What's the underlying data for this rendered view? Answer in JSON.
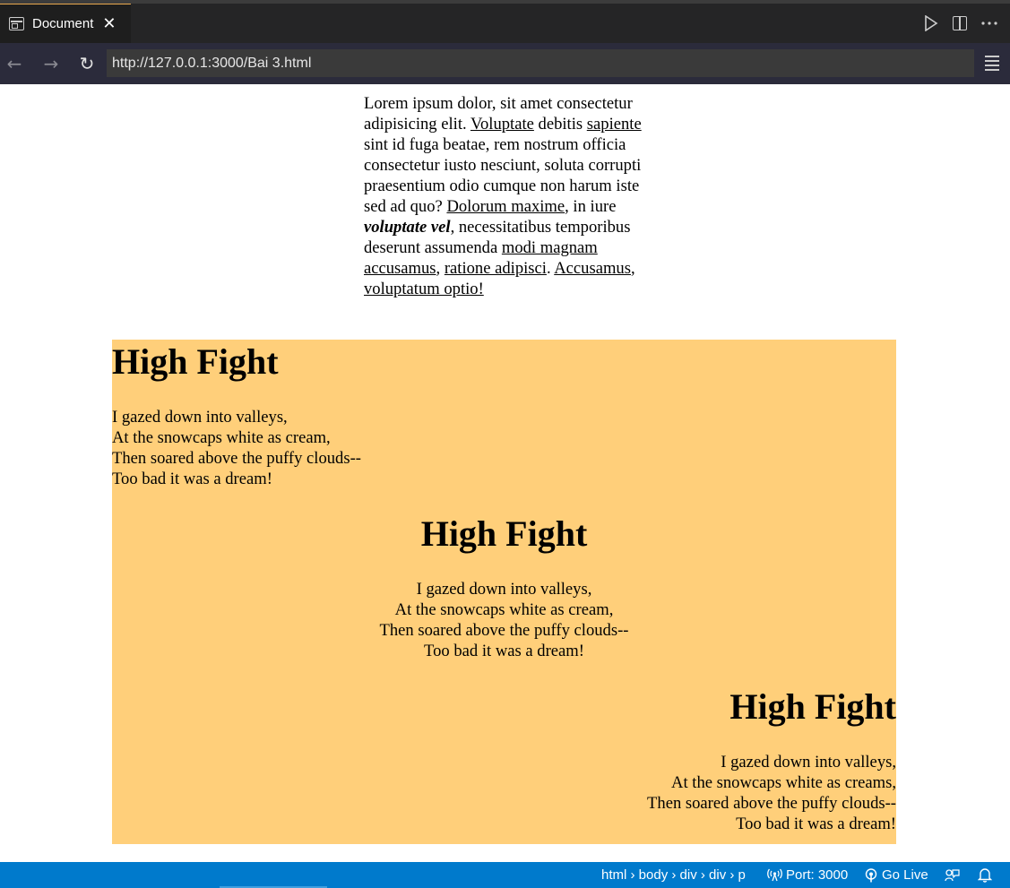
{
  "tab": {
    "title": "Document",
    "close": "✕"
  },
  "nav": {
    "back": "←",
    "forward": "→",
    "reload": "↻",
    "url": "http://127.0.0.1:3000/Bai 3.html"
  },
  "content": {
    "lorem": {
      "t1": "Lorem ipsum dolor, sit amet consectetur adipisicing elit. ",
      "l1": "Voluptate",
      "t2": " debitis ",
      "l2": "sapiente",
      "t3": " sint id fuga beatae, rem nostrum officia consectetur iusto nesciunt, soluta corrupti praesentium odio cumque non harum iste sed ad quo? ",
      "l3": "Dolorum maxime",
      "t4": ", in iure ",
      "em": "voluptate vel",
      "t5": ", necessitatibus temporibus deserunt assumenda ",
      "l4": "modi magnam accusamus",
      "t6": ", ",
      "l5": "ratione adipisci",
      "t7": ". ",
      "l6": "Accusamus",
      "t8": ", ",
      "l7": "voluptatum optio!"
    },
    "poems": [
      {
        "title": "High Fight",
        "lines": [
          "I gazed down into valleys,",
          "At the snowcaps white as cream,",
          "Then soared above the puffy clouds--",
          "Too bad it was a dream!"
        ]
      },
      {
        "title": "High Fight",
        "lines": [
          "I gazed down into valleys,",
          "At the snowcaps white as cream,",
          "Then soared above the puffy clouds--",
          "Too bad it was a dream!"
        ]
      },
      {
        "title": "High Fight",
        "lines": [
          "I gazed down into valleys,",
          "At the snowcaps white as creams,",
          "Then soared above the puffy clouds--",
          "Too bad it was a dream!"
        ]
      }
    ]
  },
  "status": {
    "breadcrumb": "html › body › div › div › p",
    "port": "Port: 3000",
    "golive": "Go Live"
  }
}
